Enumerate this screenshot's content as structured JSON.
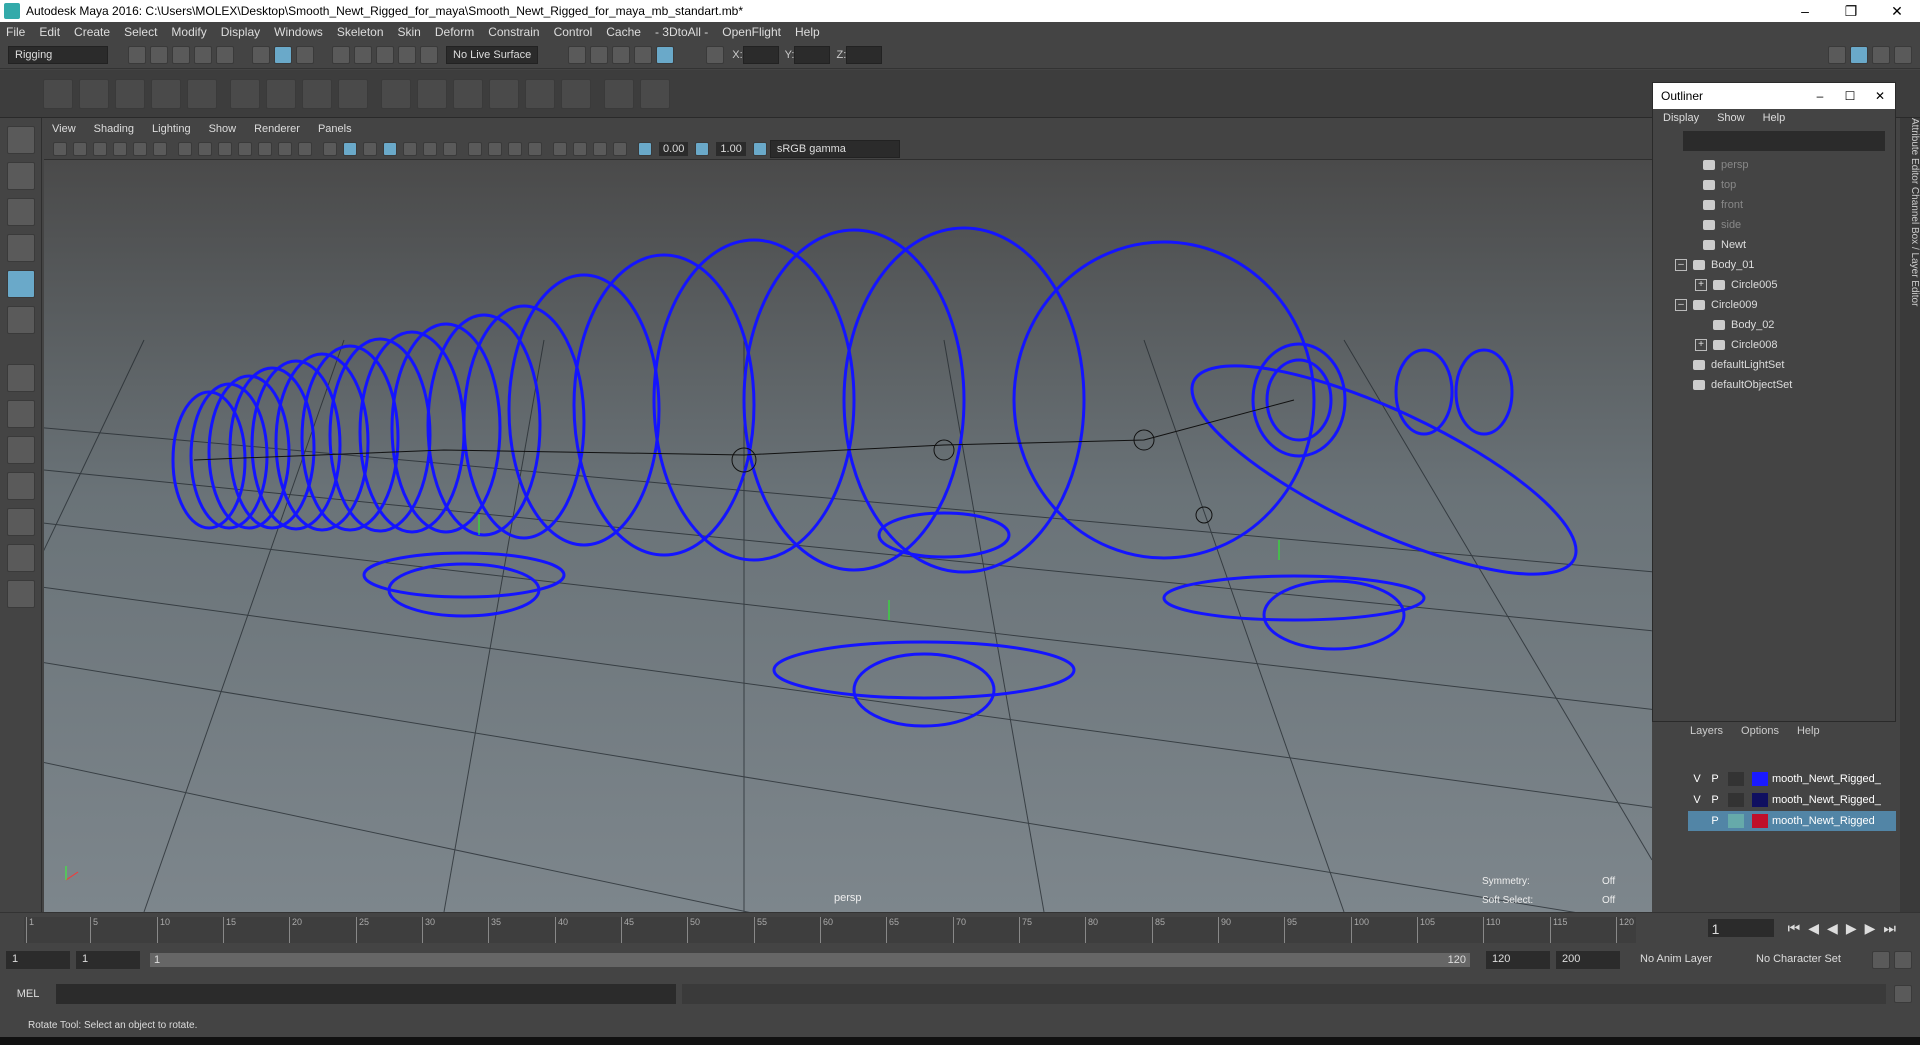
{
  "title": "Autodesk Maya 2016: C:\\Users\\MOLEX\\Desktop\\Smooth_Newt_Rigged_for_maya\\Smooth_Newt_Rigged_for_maya_mb_standart.mb*",
  "menus": [
    "File",
    "Edit",
    "Create",
    "Select",
    "Modify",
    "Display",
    "Windows",
    "Skeleton",
    "Skin",
    "Deform",
    "Constrain",
    "Control",
    "Cache",
    "- 3DtoAll -",
    "OpenFlight",
    "Help"
  ],
  "status": {
    "mode": "Rigging",
    "live_surface": "No Live Surface",
    "x_label": "X:",
    "y_label": "Y:",
    "z_label": "Z:"
  },
  "viewport": {
    "menu": [
      "View",
      "Shading",
      "Lighting",
      "Show",
      "Renderer",
      "Panels"
    ],
    "exposure": "0.00",
    "gamma": "1.00",
    "colorspace": "sRGB gamma",
    "camera": "persp",
    "symmetry_label": "Symmetry:",
    "symmetry_value": "Off",
    "softselect_label": "Soft Select:",
    "softselect_value": "Off"
  },
  "outliner": {
    "title": "Outliner",
    "menu": [
      "Display",
      "Show",
      "Help"
    ],
    "items": [
      {
        "label": "persp"
      },
      {
        "label": "top"
      },
      {
        "label": "front"
      },
      {
        "label": "side"
      },
      {
        "label": "Newt"
      },
      {
        "label": "Body_01"
      },
      {
        "label": "Circle005"
      },
      {
        "label": "Circle009"
      },
      {
        "label": "Body_02"
      },
      {
        "label": "Circle008"
      },
      {
        "label": "defaultLightSet"
      },
      {
        "label": "defaultObjectSet"
      }
    ]
  },
  "layers": {
    "menu": [
      "Layers",
      "Options",
      "Help"
    ],
    "rows": [
      {
        "v": "V",
        "p": "P",
        "name": "mooth_Newt_Rigged_",
        "color": "#1a1aff"
      },
      {
        "v": "V",
        "p": "P",
        "name": "mooth_Newt_Rigged_",
        "color": "#101060"
      },
      {
        "v": "",
        "p": "P",
        "name": "mooth_Newt_Rigged",
        "color": "#c0102a"
      }
    ]
  },
  "side_tabs": "Attribute Editor   Channel Box / Layer Editor",
  "timeline": {
    "ticks": [
      "5",
      "10",
      "15",
      "20",
      "25",
      "30",
      "35",
      "40",
      "45",
      "50",
      "55",
      "60",
      "65",
      "70",
      "75",
      "80",
      "85",
      "90",
      "95",
      "100",
      "105",
      "110",
      "115",
      "120"
    ],
    "start_tick": "1",
    "current_frame": "1"
  },
  "range": {
    "start": "1",
    "inner_start": "1",
    "slider_start": "1",
    "slider_end": "120",
    "end": "120",
    "max": "200",
    "anim_layer": "No Anim Layer",
    "char_set": "No Character Set"
  },
  "mel": {
    "label": "MEL"
  },
  "help_line": "Rotate Tool: Select an object to rotate.",
  "colors": {
    "wire": "#1414ff",
    "accent": "#5285a6"
  }
}
